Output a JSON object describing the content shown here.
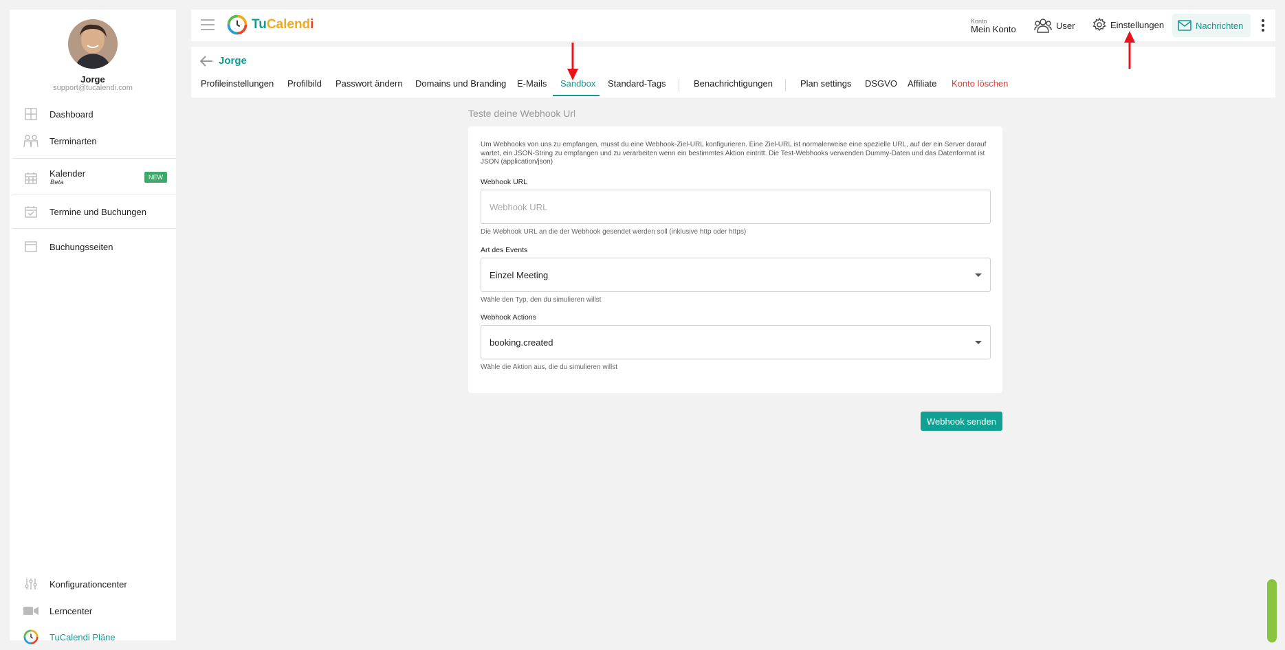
{
  "user": {
    "name": "Jorge",
    "email": "support@tucalendi.com"
  },
  "sidebar": {
    "items": [
      {
        "label": "Dashboard",
        "icon": "dashboard-icon"
      },
      {
        "label": "Terminarten",
        "icon": "people-icon"
      },
      {
        "label": "Kalender",
        "sub": "Beta",
        "badge": "NEW",
        "icon": "calendar-icon"
      },
      {
        "label": "Termine und Buchungen",
        "icon": "calendar-check-icon"
      },
      {
        "label": "Buchungsseiten",
        "icon": "window-icon"
      }
    ],
    "bottom": [
      {
        "label": "Konfigurationcenter",
        "icon": "sliders-icon"
      },
      {
        "label": "Lerncenter",
        "icon": "video-icon"
      },
      {
        "label": "TuCalendi Pläne",
        "icon": "tucalendi-logo-icon"
      }
    ]
  },
  "header": {
    "logo_tu": "Tu",
    "logo_calend": "Calend",
    "logo_i": "i",
    "konto_label": "Konto",
    "konto_value": "Mein Konto",
    "user_label": "User",
    "settings_label": "Einstellungen",
    "messages_label": "Nachrichten"
  },
  "profile": {
    "back_name": "Jorge",
    "tabs": [
      "Profileinstellungen",
      "Profilbild",
      "Passwort ändern",
      "Domains und Branding",
      "E-Mails",
      "Sandbox",
      "Standard-Tags",
      "Benachrichtigungen",
      "Plan settings",
      "DSGVO",
      "Affiliate",
      "Konto löschen"
    ],
    "active_tab": "Sandbox"
  },
  "webhook": {
    "section_title": "Teste deine Webhook Url",
    "intro": "Um Webhooks von uns zu empfangen, musst du eine Webhook-Ziel-URL konfigurieren. Eine Ziel-URL ist normalerweise eine spezielle URL, auf der ein Server darauf wartet, ein JSON-String zu empfangen und zu verarbeiten wenn ein bestimmtes Aktion eintritt. Die Test-Webhooks verwenden Dummy-Daten und das Datenformat ist JSON (application/json)",
    "url_label": "Webhook URL",
    "url_placeholder": "Webhook URL",
    "url_help": "Die Webhook URL an die der Webhook gesendet werden soll (inklusive http oder https)",
    "event_label": "Art des Events",
    "event_value": "Einzel Meeting",
    "event_help": "Wähle den Typ, den du simulieren willst",
    "actions_label": "Webhook Actions",
    "actions_value": "booking.created",
    "actions_help": "Wähle die Aktion aus, die du simulieren willst",
    "send_label": "Webhook senden"
  },
  "colors": {
    "accent": "#0f9b92",
    "danger": "#e03a3a",
    "badge": "#3fa86a",
    "annotation": "#e8141b"
  }
}
